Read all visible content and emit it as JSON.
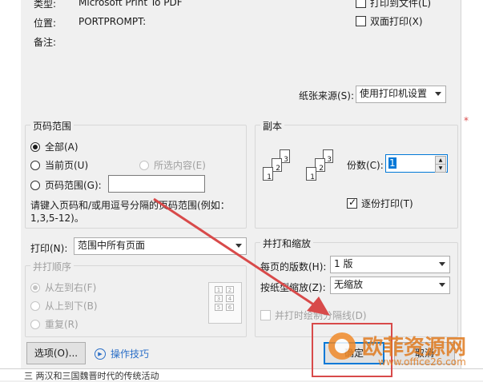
{
  "printer": {
    "type_label": "类型:",
    "type_value": "Microsoft Print To PDF",
    "location_label": "位置:",
    "location_value": "PORTPROMPT:",
    "comment_label": "备注:",
    "print_to_file": "打印到文件(L)",
    "duplex": "双面打印(X)",
    "paper_source_label": "纸张来源(S):",
    "paper_source_value": "使用打印机设置"
  },
  "page_range": {
    "title": "页码范围",
    "all": "全部(A)",
    "current": "当前页(U)",
    "selection": "所选内容(E)",
    "range": "页码范围(G):",
    "range_value": "",
    "hint": "请键入页码和/或用逗号分隔的页码范围(例如：1,3,5-12)。"
  },
  "copies": {
    "title": "副本",
    "count_label": "份数(C):",
    "count_value": "1",
    "collate": "逐份打印(T)"
  },
  "print_what": {
    "label": "打印(N):",
    "value": "范围中所有页面"
  },
  "order": {
    "title": "并打顺序",
    "ltr": "从左到右(F)",
    "ttb": "从上到下(B)",
    "repeat": "重复(R)"
  },
  "zoom": {
    "title": "并打和缩放",
    "pages_per_sheet_label": "每页的版数(H):",
    "pages_per_sheet_value": "1 版",
    "scale_label": "按纸型缩放(Z):",
    "scale_value": "无缩放",
    "draw_borders": "并打时绘制分隔线(D)"
  },
  "footer": {
    "options": "选项(O)...",
    "tips": "操作技巧",
    "ok": "确定",
    "cancel": "取消"
  },
  "watermark": {
    "text": "欧菲资源网",
    "url": "www.office26.com"
  },
  "background_text": "三  两汉和三国魏晋时代的传统活动",
  "colors": {
    "accent": "#0078d7",
    "annotation_red": "#d84a4a",
    "tips_link": "#2b6fc7"
  }
}
